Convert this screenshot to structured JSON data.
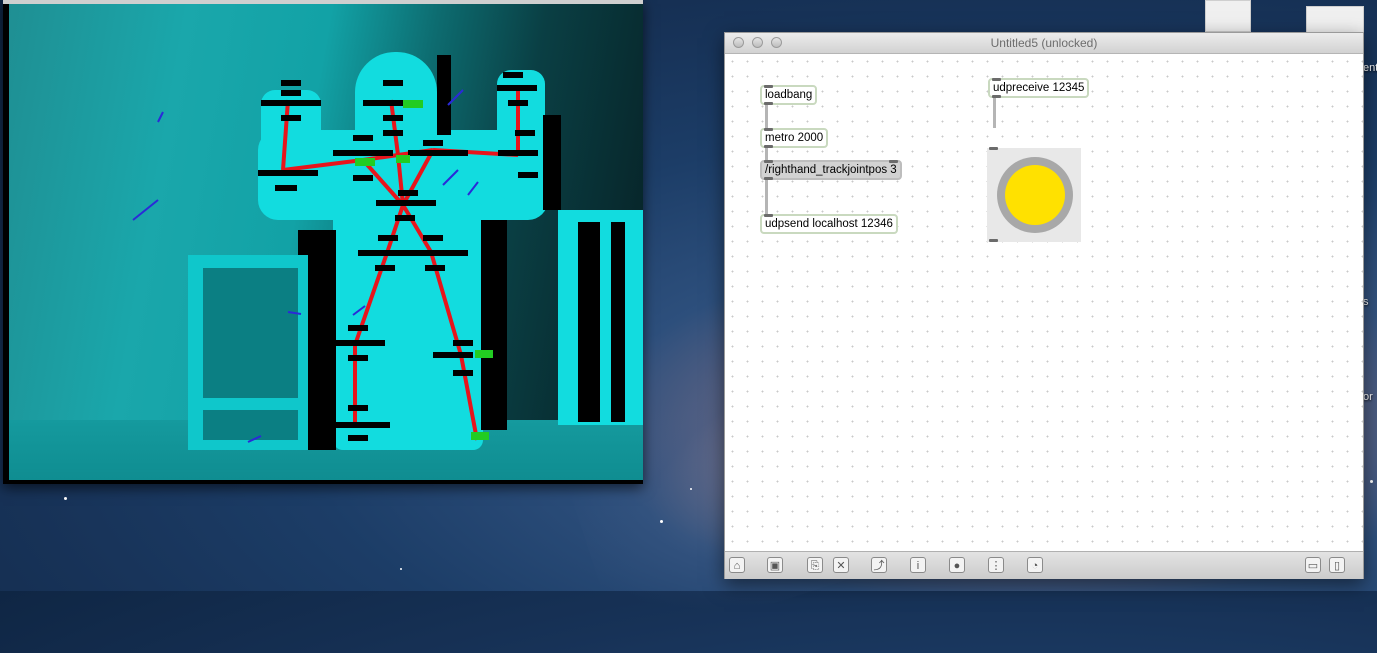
{
  "patcher": {
    "title": "Untitled5 (unlocked)",
    "objects": {
      "loadbang": "loadbang",
      "metro": "metro 2000",
      "message": "/righthand_trackjointpos 3",
      "udpsend": "udpsend localhost 12346",
      "udpreceive": "udpreceive 12345"
    },
    "toggle_color": "#ffe100",
    "toolbar_icons": [
      "lock-icon",
      "new-view-icon",
      "clue-icon",
      "close-box-icon",
      "inspector-chart-icon",
      "info-icon",
      "connect-icon",
      "grid-icon",
      "clock-icon",
      "left-panel-icon",
      "right-panel-icon"
    ]
  },
  "desktop": {
    "edge_labels": [
      "ent",
      "s",
      "or"
    ]
  }
}
